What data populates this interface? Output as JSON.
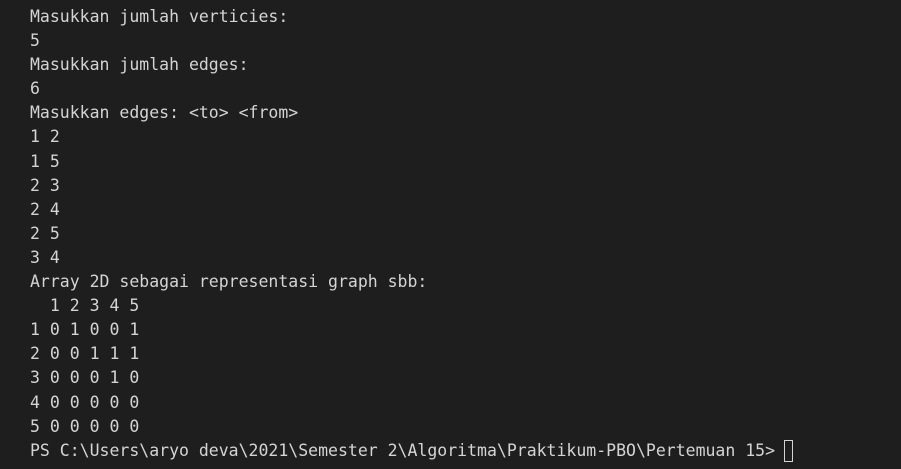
{
  "terminal": {
    "top_fragment": "    . .",
    "lines": [
      "Masukkan jumlah verticies:",
      "5",
      "Masukkan jumlah edges:",
      "6",
      "Masukkan edges: <to> <from>",
      "1 2",
      "1 5",
      "2 3",
      "2 4",
      "2 5",
      "3 4",
      "Array 2D sebagai representasi graph sbb:",
      "  1 2 3 4 5",
      "1 0 1 0 0 1",
      "2 0 0 1 1 1",
      "3 0 0 0 1 0",
      "4 0 0 0 0 0",
      "5 0 0 0 0 0"
    ],
    "prompt": "PS C:\\Users\\aryo deva\\2021\\Semester 2\\Algoritma\\Praktikum-PBO\\Pertemuan 15>"
  },
  "colors": {
    "background": "#1e1e1e",
    "text": "#d4d4d4",
    "accent": "#3a96dd"
  }
}
